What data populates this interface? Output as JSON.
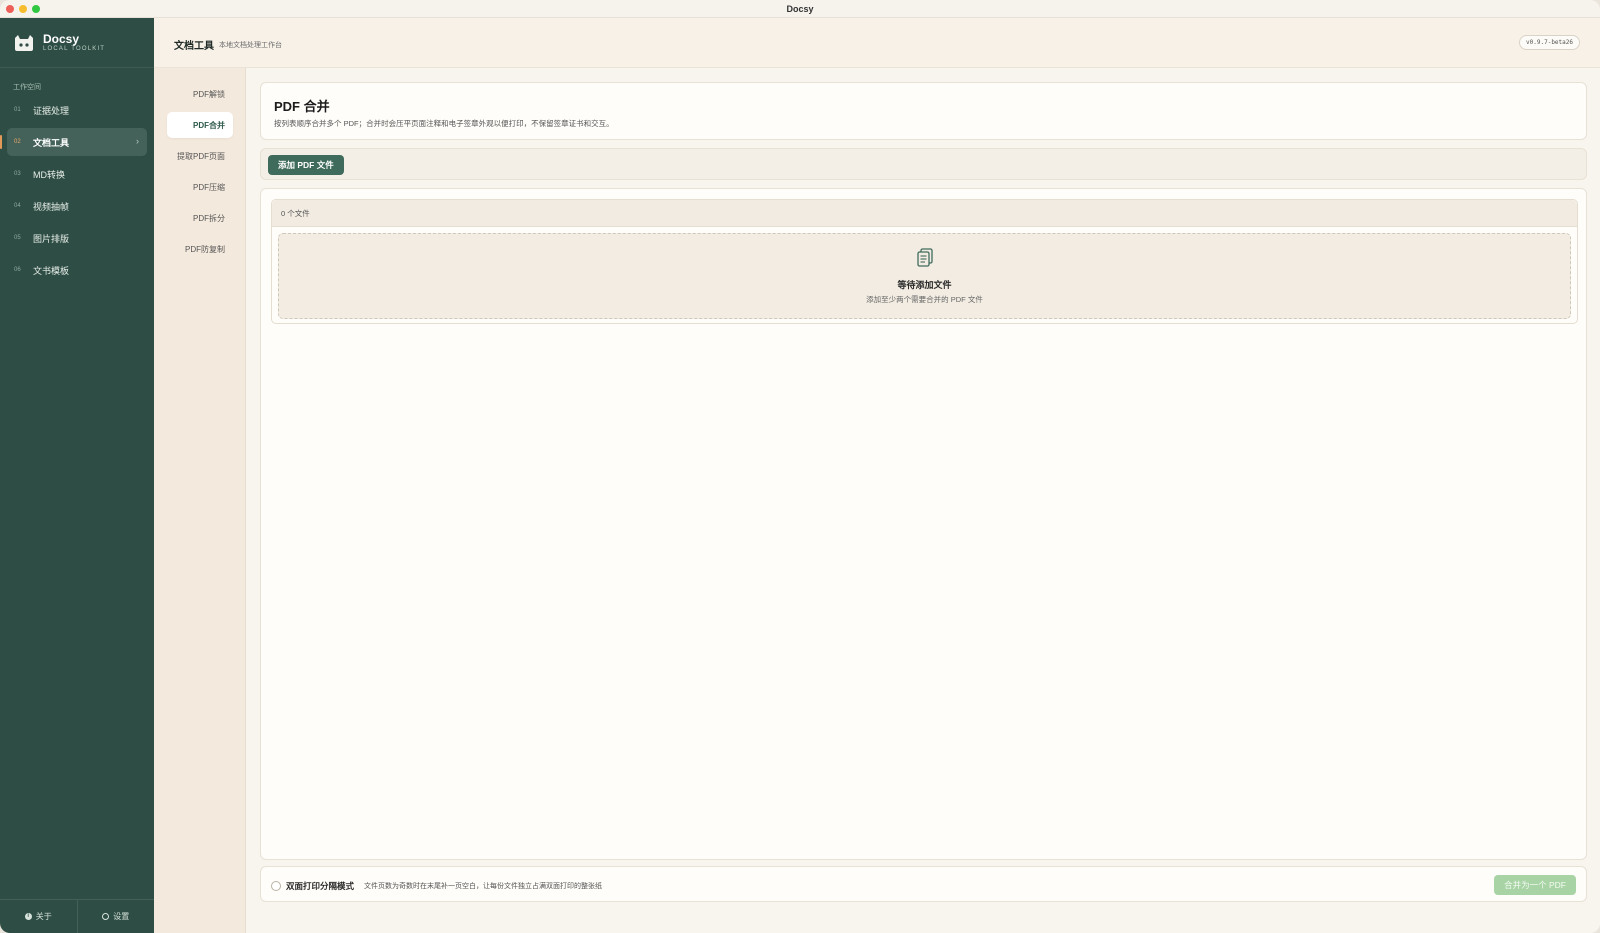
{
  "window": {
    "title": "Docsy"
  },
  "brand": {
    "name": "Docsy",
    "subtitle": "LOCAL TOOLKIT"
  },
  "sidebar": {
    "section_label": "工作空间",
    "items": [
      {
        "num": "01",
        "label": "证据处理"
      },
      {
        "num": "02",
        "label": "文档工具",
        "active": true
      },
      {
        "num": "03",
        "label": "MD转换"
      },
      {
        "num": "04",
        "label": "视频抽帧"
      },
      {
        "num": "05",
        "label": "图片排版"
      },
      {
        "num": "06",
        "label": "文书模板"
      }
    ],
    "active_chevron": "›",
    "footer": {
      "about": "关于",
      "settings": "设置"
    }
  },
  "header": {
    "title": "文档工具",
    "subtitle": "本地文档处理工作台",
    "version": "v0.9.7-beta26"
  },
  "subnav": {
    "items": [
      "PDF解锁",
      "PDF合并",
      "提取PDF页面",
      "PDF压缩",
      "PDF拆分",
      "PDF防复制"
    ],
    "active_index": 1
  },
  "main": {
    "title": "PDF 合并",
    "description": "按列表顺序合并多个 PDF；合并时会压平页面注释和电子签章外观以便打印，不保留签章证书和交互。",
    "add_button": "添加 PDF 文件",
    "file_count": "0 个文件",
    "empty_title": "等待添加文件",
    "empty_subtitle": "添加至少两个需要合并的 PDF 文件",
    "duplex_label": "双面打印分隔模式",
    "duplex_desc": "文件页数为奇数时在末尾补一页空白，让每份文件独立占满双面打印的整张纸",
    "merge_button": "合并为一个 PDF"
  },
  "colors": {
    "sidebar_bg": "#2e4d45",
    "accent": "#3f6b5d",
    "active_marker": "#e39a59",
    "merge_disabled": "#a8d3a5"
  }
}
